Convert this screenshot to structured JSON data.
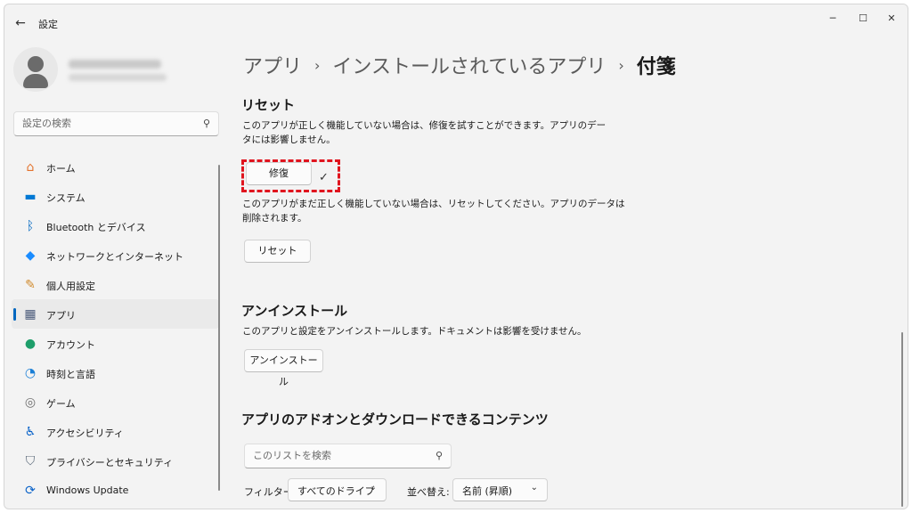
{
  "window": {
    "title": "設定",
    "back_icon": "arrow-left-icon",
    "controls": {
      "minimize": "─",
      "maximize": "☐",
      "close": "✕"
    }
  },
  "sidebar": {
    "search_placeholder": "設定の検索",
    "search_icon": "⚲",
    "items": [
      {
        "label": "ホーム",
        "icon": "⌂",
        "icon_name": "home-icon",
        "color": "#e3732d",
        "active": false
      },
      {
        "label": "システム",
        "icon": "▬",
        "icon_name": "system-icon",
        "color": "#0078d4",
        "active": false
      },
      {
        "label": "Bluetooth とデバイス",
        "icon": "ᛒ",
        "icon_name": "bluetooth-icon",
        "color": "#0067c0",
        "active": false
      },
      {
        "label": "ネットワークとインターネット",
        "icon": "◆",
        "icon_name": "network-icon",
        "color": "#1a8cff",
        "active": false
      },
      {
        "label": "個人用設定",
        "icon": "✎",
        "icon_name": "personalization-icon",
        "color": "#d08a2c",
        "active": false
      },
      {
        "label": "アプリ",
        "icon": "▦",
        "icon_name": "apps-icon",
        "color": "#4a5a7a",
        "active": true
      },
      {
        "label": "アカウント",
        "icon": "●",
        "icon_name": "account-icon",
        "color": "#1e9e6a",
        "active": false
      },
      {
        "label": "時刻と言語",
        "icon": "◔",
        "icon_name": "time-language-icon",
        "color": "#1a7fd6",
        "active": false
      },
      {
        "label": "ゲーム",
        "icon": "◎",
        "icon_name": "gaming-icon",
        "color": "#6d6d6d",
        "active": false
      },
      {
        "label": "アクセシビリティ",
        "icon": "♿",
        "icon_name": "accessibility-icon",
        "color": "#0a63c9",
        "active": false
      },
      {
        "label": "プライバシーとセキュリティ",
        "icon": "⛉",
        "icon_name": "privacy-shield-icon",
        "color": "#5c6a7a",
        "active": false
      },
      {
        "label": "Windows Update",
        "icon": "⟳",
        "icon_name": "windows-update-icon",
        "color": "#0a63c9",
        "active": false
      }
    ]
  },
  "breadcrumb": {
    "level1": "アプリ",
    "level2": "インストールされているアプリ",
    "current": "付箋",
    "separator": "›"
  },
  "reset_section": {
    "heading": "リセット",
    "repair_desc_line1": "このアプリが正しく機能していない場合は、修復を試すことができます。アプリのデー",
    "repair_desc_line2": "タには影響しません。",
    "repair_button": "修復",
    "repair_done_icon": "✓",
    "reset_desc_line1": "このアプリがまだ正しく機能していない場合は、リセットしてください。アプリのデータは",
    "reset_desc_line2": "削除されます。",
    "reset_button": "リセット"
  },
  "uninstall_section": {
    "heading": "アンインストール",
    "desc": "このアプリと設定をアンインストールします。ドキュメントは影響を受けません。",
    "button": "アンインストール"
  },
  "addons_section": {
    "heading": "アプリのアドオンとダウンロードできるコンテンツ",
    "search_placeholder": "このリストを検索",
    "filter_label": "フィルター:",
    "filter_value": "すべてのドライブ",
    "sort_label": "並べ替え:",
    "sort_value": "名前 (昇順)"
  },
  "colors": {
    "accent": "#0067c0",
    "highlight_border": "#e0141e"
  }
}
